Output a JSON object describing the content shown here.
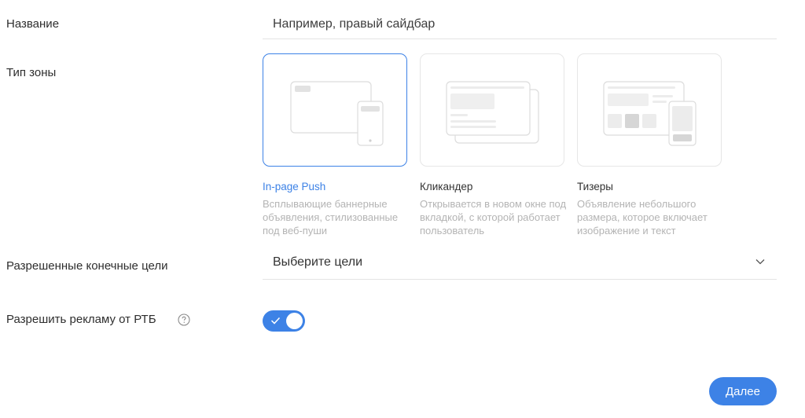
{
  "form": {
    "name_label": "Название",
    "name_placeholder": "Например, правый сайдбар",
    "zone_type_label": "Тип зоны",
    "zone_types": [
      {
        "title": "In-page Push",
        "description": "Всплывающие баннерные объявления, стилизованные под веб-пуши",
        "selected": true
      },
      {
        "title": "Кликандер",
        "description": "Открывается в новом окне под вкладкой, с которой работает пользователь",
        "selected": false
      },
      {
        "title": "Тизеры",
        "description": "Объявление небольшого размера, которое включает изображение и текст",
        "selected": false
      }
    ],
    "goals_label": "Разрешенные конечные цели",
    "goals_value": "Выберите цели",
    "rtb_label": "Разрешить рекламу от РТБ",
    "rtb_enabled": true,
    "next_button": "Далее"
  },
  "colors": {
    "accent": "#3d82e6",
    "muted": "#b4b4b4",
    "border": "#e6e6e6"
  },
  "icons": {
    "help": "question-circle-icon",
    "chevron": "chevron-down-icon",
    "check": "check-icon"
  }
}
